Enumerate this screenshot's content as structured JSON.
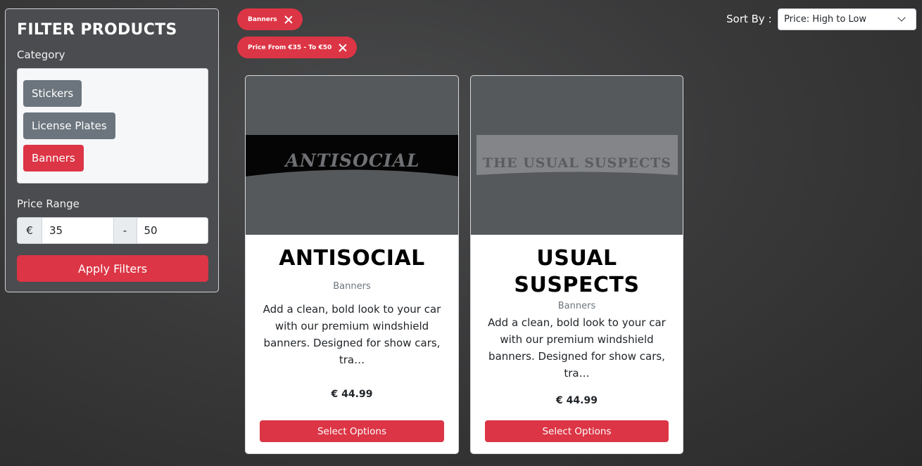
{
  "filter": {
    "title": "FILTER PRODUCTS",
    "category_label": "Category",
    "categories": [
      {
        "label": "Stickers",
        "active": false
      },
      {
        "label": "License Plates",
        "active": false
      },
      {
        "label": "Banners",
        "active": true
      }
    ],
    "price_label": "Price Range",
    "currency_symbol": "€",
    "price_separator": "-",
    "price_min": "35",
    "price_max": "50",
    "apply_label": "Apply Filters"
  },
  "active_filters": [
    {
      "label": "Banners"
    },
    {
      "label": "Price From €35 - To €50"
    }
  ],
  "sort": {
    "label": "Sort By :",
    "selected": "Price: High to Low"
  },
  "products": [
    {
      "image_text": "ANTISOCIAL",
      "title": "ANTISOCIAL",
      "category": "Banners",
      "description": "Add a clean, bold look to your car with our premium windshield banners. Designed for show cars, tra…",
      "price": "€ 44.99",
      "button_label": "Select Options"
    },
    {
      "image_text": "THE USUAL SUSPECTS",
      "title": "USUAL SUSPECTS",
      "category": "Banners",
      "description": "Add a clean, bold look to your car with our premium windshield banners. Designed for show cars, tra…",
      "price": "€ 44.99",
      "button_label": "Select Options"
    }
  ],
  "colors": {
    "accent": "#dc3545",
    "secondary": "#6c757d",
    "panel": "#4a4c4f",
    "page_bg": "#3a3a3b"
  }
}
